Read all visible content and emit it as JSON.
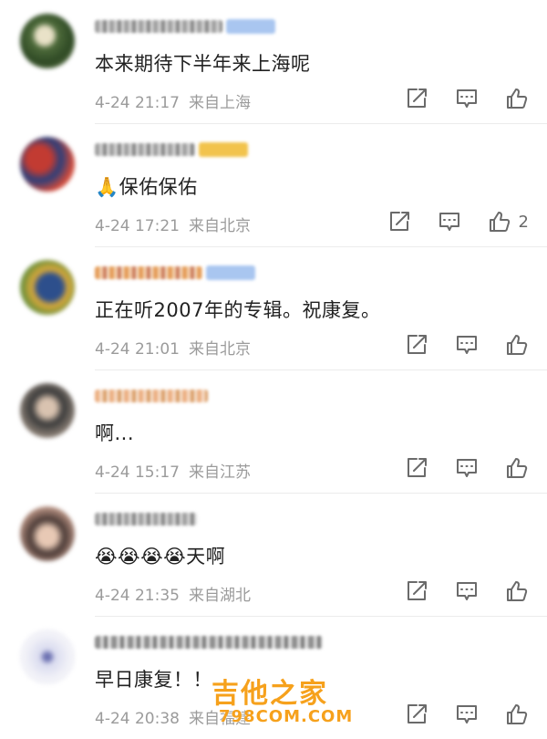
{
  "comments": [
    {
      "text": "本来期待下半年来上海呢",
      "date": "4-24 21:17",
      "location": "来自上海",
      "likes": ""
    },
    {
      "text": "🙏保佑保佑",
      "date": "4-24 17:21",
      "location": "来自北京",
      "likes": "2"
    },
    {
      "text": "正在听2007年的专辑。祝康复。",
      "date": "4-24 21:01",
      "location": "来自北京",
      "likes": ""
    },
    {
      "text": "啊...",
      "date": "4-24 15:17",
      "location": "来自江苏",
      "likes": ""
    },
    {
      "text": "😭😭😭😭天啊",
      "date": "4-24 21:35",
      "location": "来自湖北",
      "likes": ""
    },
    {
      "text": "早日康复！！",
      "date": "4-24 20:38",
      "location": "来自福建",
      "likes": ""
    }
  ],
  "watermark": {
    "title": "吉他之家",
    "subtitle": "798COM.COM"
  },
  "icons": {
    "share": "share-icon",
    "comment": "comment-icon",
    "like": "like-icon"
  },
  "colors": {
    "text": "#222222",
    "meta": "#9b9b9b",
    "icon": "#6a6a6a",
    "watermark": "#f6a11c"
  }
}
